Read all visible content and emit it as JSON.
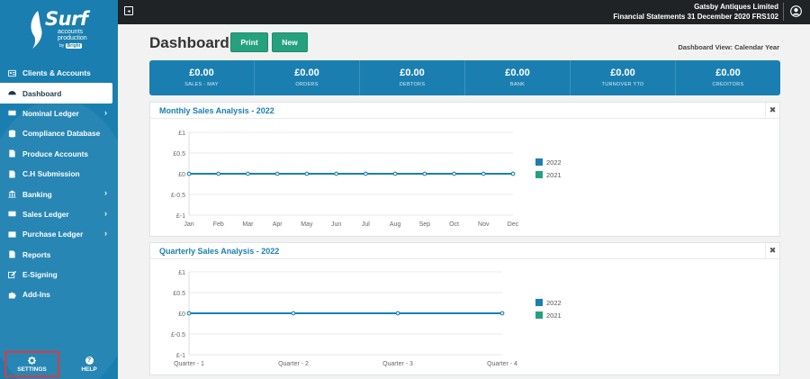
{
  "logo": {
    "word": "Surf",
    "sub1": "accounts",
    "sub2": "production",
    "by_prefix": "by",
    "by_brand": "Bright"
  },
  "sidebar": {
    "items": [
      {
        "label": "Clients & Accounts",
        "icon": "id-card-icon",
        "active": false,
        "chevron": false
      },
      {
        "label": "Dashboard",
        "icon": "dashboard-icon",
        "active": true,
        "chevron": false
      },
      {
        "label": "Nominal Ledger",
        "icon": "ledger-icon",
        "active": false,
        "chevron": true
      },
      {
        "label": "Compliance Database",
        "icon": "database-icon",
        "active": false,
        "chevron": false
      },
      {
        "label": "Produce Accounts",
        "icon": "document-icon",
        "active": false,
        "chevron": false
      },
      {
        "label": "C.H Submission",
        "icon": "file-icon",
        "active": false,
        "chevron": false
      },
      {
        "label": "Banking",
        "icon": "bank-icon",
        "active": false,
        "chevron": true
      },
      {
        "label": "Sales Ledger",
        "icon": "sales-icon",
        "active": false,
        "chevron": true
      },
      {
        "label": "Purchase Ledger",
        "icon": "cart-icon",
        "active": false,
        "chevron": true
      },
      {
        "label": "Reports",
        "icon": "chart-icon",
        "active": false,
        "chevron": false
      },
      {
        "label": "E-Signing",
        "icon": "pen-icon",
        "active": false,
        "chevron": false
      },
      {
        "label": "Add-Ins",
        "icon": "puzzle-icon",
        "active": false,
        "chevron": false
      }
    ],
    "settings_label": "SETTINGS",
    "help_label": "HELP",
    "help_glyph": "?"
  },
  "topbar": {
    "company": "Gatsby Antiques Limited",
    "subtitle": "Financial Statements 31 December 2020 FRS102"
  },
  "header": {
    "title": "Dashboard",
    "print_label": "Print",
    "new_label": "New",
    "view_label": "Dashboard View: Calendar Year"
  },
  "stats": [
    {
      "value": "£0.00",
      "label": "SALES - MAY"
    },
    {
      "value": "£0.00",
      "label": "ORDERS"
    },
    {
      "value": "£0.00",
      "label": "DEBTORS"
    },
    {
      "value": "£0.00",
      "label": "BANK"
    },
    {
      "value": "£0.00",
      "label": "TURNOVER YTD"
    },
    {
      "value": "£0.00",
      "label": "CREDITORS"
    }
  ],
  "colors": {
    "brand": "#1a7fb0",
    "accent_green": "#26a17e",
    "series_2022": "#1a7fb0",
    "series_2021": "#26a17e",
    "sidebar": "#1a7fb0",
    "topbar": "#202326"
  },
  "chart_data": [
    {
      "type": "line",
      "title": "Monthly Sales Analysis - 2022",
      "categories": [
        "Jan",
        "Feb",
        "Mar",
        "Apr",
        "May",
        "Jun",
        "Jul",
        "Aug",
        "Sep",
        "Oct",
        "Nov",
        "Dec"
      ],
      "yticks": [
        "£1",
        "£0.5",
        "£0",
        "£-0.5",
        "£-1"
      ],
      "ylim": [
        -1,
        1
      ],
      "series": [
        {
          "name": "2022",
          "values": [
            0,
            0,
            0,
            0,
            0,
            0,
            0,
            0,
            0,
            0,
            0,
            0
          ]
        },
        {
          "name": "2021",
          "values": [
            0,
            0,
            0,
            0,
            0,
            0,
            0,
            0,
            0,
            0,
            0,
            0
          ]
        }
      ],
      "legend": "right"
    },
    {
      "type": "line",
      "title": "Quarterly Sales Analysis - 2022",
      "categories": [
        "Quarter - 1",
        "Quarter - 2",
        "Quarter - 3",
        "Quarter - 4"
      ],
      "yticks": [
        "£1",
        "£0.5",
        "£0",
        "£-0.5",
        "£-1"
      ],
      "ylim": [
        -1,
        1
      ],
      "series": [
        {
          "name": "2022",
          "values": [
            0,
            0,
            0,
            0
          ]
        },
        {
          "name": "2021",
          "values": [
            0,
            0,
            0,
            0
          ]
        }
      ],
      "legend": "right"
    }
  ]
}
